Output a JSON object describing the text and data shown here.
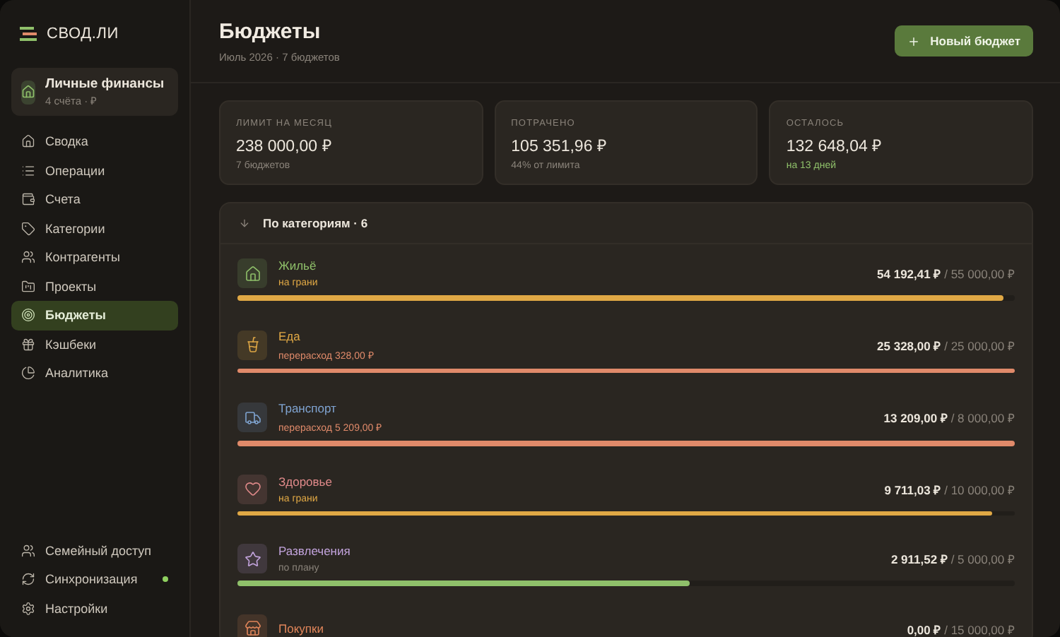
{
  "brand": {
    "name": "СВОД.ЛИ"
  },
  "workspace": {
    "name": "Личные финансы",
    "meta": "4 счёта · ₽"
  },
  "nav": [
    {
      "label": "Сводка",
      "selected": false
    },
    {
      "label": "Операции",
      "selected": false
    },
    {
      "label": "Счета",
      "selected": false
    },
    {
      "label": "Категории",
      "selected": false
    },
    {
      "label": "Контрагенты",
      "selected": false
    },
    {
      "label": "Проекты",
      "selected": false
    },
    {
      "label": "Бюджеты",
      "selected": true
    },
    {
      "label": "Кэшбеки",
      "selected": false
    },
    {
      "label": "Аналитика",
      "selected": false
    }
  ],
  "footer_nav": [
    {
      "label": "Семейный доступ",
      "online": false
    },
    {
      "label": "Синхронизация",
      "online": true
    },
    {
      "label": "Настройки",
      "online": false
    }
  ],
  "header": {
    "title": "Бюджеты",
    "subtitle": "Июль 2026 · 7 бюджетов",
    "button": "Новый бюджет"
  },
  "stats": [
    {
      "label": "ЛИМИТ НА МЕСЯЦ",
      "value": "238 000,00 ₽",
      "note": "7 бюджетов",
      "positive": false
    },
    {
      "label": "ПОТРАЧЕНО",
      "value": "105 351,96 ₽",
      "note": "44% от лимита",
      "positive": false
    },
    {
      "label": "ОСТАЛОСЬ",
      "value": "132 648,04 ₽",
      "note": "на 13 дней",
      "positive": true
    }
  ],
  "categories": {
    "title": "По категориям · 6",
    "items": [
      {
        "name": "Жильё",
        "color": "#8fc06a",
        "status": "на грани",
        "kind": "edge",
        "spent": "54 192,41 ₽",
        "limit": "/ 55 000,00 ₽",
        "level": 0.985
      },
      {
        "name": "Еда",
        "color": "#e0a845",
        "status": "перерасход 328,00 ₽",
        "kind": "over",
        "spent": "25 328,00 ₽",
        "limit": "/ 25 000,00 ₽",
        "level": 1
      },
      {
        "name": "Транспорт",
        "color": "#7fa3d0",
        "status": "перерасход 5 209,00 ₽",
        "kind": "over",
        "spent": "13 209,00 ₽",
        "limit": "/ 8 000,00 ₽",
        "level": 1
      },
      {
        "name": "Здоровье",
        "color": "#e08a8a",
        "status": "на грани",
        "kind": "edge",
        "spent": "9 711,03 ₽",
        "limit": "/ 10 000,00 ₽",
        "level": 0.971
      },
      {
        "name": "Развлечения",
        "color": "#c2a3dc",
        "status": "по плану",
        "kind": "plan",
        "spent": "2 911,52 ₽",
        "limit": "/ 5 000,00 ₽",
        "level": 0.582
      },
      {
        "name": "Покупки",
        "color": "#e0855a",
        "spent": "0,00 ₽",
        "limit": "/ 15 000,00 ₽"
      }
    ]
  }
}
